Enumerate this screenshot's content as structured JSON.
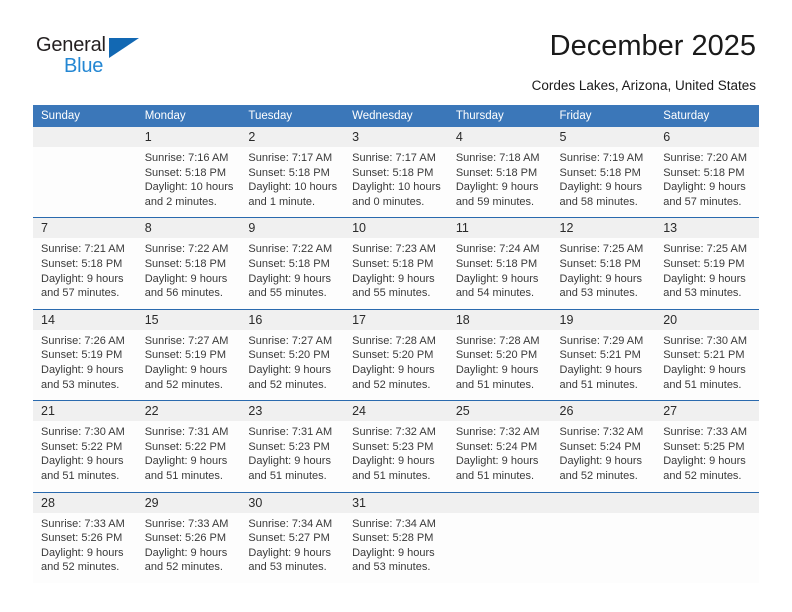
{
  "logo": {
    "text_dark": "General",
    "text_blue": "Blue",
    "triangle_color": "#1268b3",
    "blue_color": "#2487d3"
  },
  "header": {
    "title": "December 2025",
    "subtitle": "Cordes Lakes, Arizona, United States"
  },
  "theme": {
    "header_bg": "#3b77b9",
    "header_text": "#ffffff",
    "daynum_bg": "#f0f0f0",
    "week_divider": "#2a6aae",
    "cell_bg": "#fdfdfd"
  },
  "weekdays": [
    "Sunday",
    "Monday",
    "Tuesday",
    "Wednesday",
    "Thursday",
    "Friday",
    "Saturday"
  ],
  "weeks": [
    [
      {
        "day": "",
        "sunrise": "",
        "sunset": "",
        "daylight": ""
      },
      {
        "day": "1",
        "sunrise": "Sunrise: 7:16 AM",
        "sunset": "Sunset: 5:18 PM",
        "daylight": "Daylight: 10 hours and 2 minutes."
      },
      {
        "day": "2",
        "sunrise": "Sunrise: 7:17 AM",
        "sunset": "Sunset: 5:18 PM",
        "daylight": "Daylight: 10 hours and 1 minute."
      },
      {
        "day": "3",
        "sunrise": "Sunrise: 7:17 AM",
        "sunset": "Sunset: 5:18 PM",
        "daylight": "Daylight: 10 hours and 0 minutes."
      },
      {
        "day": "4",
        "sunrise": "Sunrise: 7:18 AM",
        "sunset": "Sunset: 5:18 PM",
        "daylight": "Daylight: 9 hours and 59 minutes."
      },
      {
        "day": "5",
        "sunrise": "Sunrise: 7:19 AM",
        "sunset": "Sunset: 5:18 PM",
        "daylight": "Daylight: 9 hours and 58 minutes."
      },
      {
        "day": "6",
        "sunrise": "Sunrise: 7:20 AM",
        "sunset": "Sunset: 5:18 PM",
        "daylight": "Daylight: 9 hours and 57 minutes."
      }
    ],
    [
      {
        "day": "7",
        "sunrise": "Sunrise: 7:21 AM",
        "sunset": "Sunset: 5:18 PM",
        "daylight": "Daylight: 9 hours and 57 minutes."
      },
      {
        "day": "8",
        "sunrise": "Sunrise: 7:22 AM",
        "sunset": "Sunset: 5:18 PM",
        "daylight": "Daylight: 9 hours and 56 minutes."
      },
      {
        "day": "9",
        "sunrise": "Sunrise: 7:22 AM",
        "sunset": "Sunset: 5:18 PM",
        "daylight": "Daylight: 9 hours and 55 minutes."
      },
      {
        "day": "10",
        "sunrise": "Sunrise: 7:23 AM",
        "sunset": "Sunset: 5:18 PM",
        "daylight": "Daylight: 9 hours and 55 minutes."
      },
      {
        "day": "11",
        "sunrise": "Sunrise: 7:24 AM",
        "sunset": "Sunset: 5:18 PM",
        "daylight": "Daylight: 9 hours and 54 minutes."
      },
      {
        "day": "12",
        "sunrise": "Sunrise: 7:25 AM",
        "sunset": "Sunset: 5:18 PM",
        "daylight": "Daylight: 9 hours and 53 minutes."
      },
      {
        "day": "13",
        "sunrise": "Sunrise: 7:25 AM",
        "sunset": "Sunset: 5:19 PM",
        "daylight": "Daylight: 9 hours and 53 minutes."
      }
    ],
    [
      {
        "day": "14",
        "sunrise": "Sunrise: 7:26 AM",
        "sunset": "Sunset: 5:19 PM",
        "daylight": "Daylight: 9 hours and 53 minutes."
      },
      {
        "day": "15",
        "sunrise": "Sunrise: 7:27 AM",
        "sunset": "Sunset: 5:19 PM",
        "daylight": "Daylight: 9 hours and 52 minutes."
      },
      {
        "day": "16",
        "sunrise": "Sunrise: 7:27 AM",
        "sunset": "Sunset: 5:20 PM",
        "daylight": "Daylight: 9 hours and 52 minutes."
      },
      {
        "day": "17",
        "sunrise": "Sunrise: 7:28 AM",
        "sunset": "Sunset: 5:20 PM",
        "daylight": "Daylight: 9 hours and 52 minutes."
      },
      {
        "day": "18",
        "sunrise": "Sunrise: 7:28 AM",
        "sunset": "Sunset: 5:20 PM",
        "daylight": "Daylight: 9 hours and 51 minutes."
      },
      {
        "day": "19",
        "sunrise": "Sunrise: 7:29 AM",
        "sunset": "Sunset: 5:21 PM",
        "daylight": "Daylight: 9 hours and 51 minutes."
      },
      {
        "day": "20",
        "sunrise": "Sunrise: 7:30 AM",
        "sunset": "Sunset: 5:21 PM",
        "daylight": "Daylight: 9 hours and 51 minutes."
      }
    ],
    [
      {
        "day": "21",
        "sunrise": "Sunrise: 7:30 AM",
        "sunset": "Sunset: 5:22 PM",
        "daylight": "Daylight: 9 hours and 51 minutes."
      },
      {
        "day": "22",
        "sunrise": "Sunrise: 7:31 AM",
        "sunset": "Sunset: 5:22 PM",
        "daylight": "Daylight: 9 hours and 51 minutes."
      },
      {
        "day": "23",
        "sunrise": "Sunrise: 7:31 AM",
        "sunset": "Sunset: 5:23 PM",
        "daylight": "Daylight: 9 hours and 51 minutes."
      },
      {
        "day": "24",
        "sunrise": "Sunrise: 7:32 AM",
        "sunset": "Sunset: 5:23 PM",
        "daylight": "Daylight: 9 hours and 51 minutes."
      },
      {
        "day": "25",
        "sunrise": "Sunrise: 7:32 AM",
        "sunset": "Sunset: 5:24 PM",
        "daylight": "Daylight: 9 hours and 51 minutes."
      },
      {
        "day": "26",
        "sunrise": "Sunrise: 7:32 AM",
        "sunset": "Sunset: 5:24 PM",
        "daylight": "Daylight: 9 hours and 52 minutes."
      },
      {
        "day": "27",
        "sunrise": "Sunrise: 7:33 AM",
        "sunset": "Sunset: 5:25 PM",
        "daylight": "Daylight: 9 hours and 52 minutes."
      }
    ],
    [
      {
        "day": "28",
        "sunrise": "Sunrise: 7:33 AM",
        "sunset": "Sunset: 5:26 PM",
        "daylight": "Daylight: 9 hours and 52 minutes."
      },
      {
        "day": "29",
        "sunrise": "Sunrise: 7:33 AM",
        "sunset": "Sunset: 5:26 PM",
        "daylight": "Daylight: 9 hours and 52 minutes."
      },
      {
        "day": "30",
        "sunrise": "Sunrise: 7:34 AM",
        "sunset": "Sunset: 5:27 PM",
        "daylight": "Daylight: 9 hours and 53 minutes."
      },
      {
        "day": "31",
        "sunrise": "Sunrise: 7:34 AM",
        "sunset": "Sunset: 5:28 PM",
        "daylight": "Daylight: 9 hours and 53 minutes."
      },
      {
        "day": "",
        "sunrise": "",
        "sunset": "",
        "daylight": ""
      },
      {
        "day": "",
        "sunrise": "",
        "sunset": "",
        "daylight": ""
      },
      {
        "day": "",
        "sunrise": "",
        "sunset": "",
        "daylight": ""
      }
    ]
  ]
}
